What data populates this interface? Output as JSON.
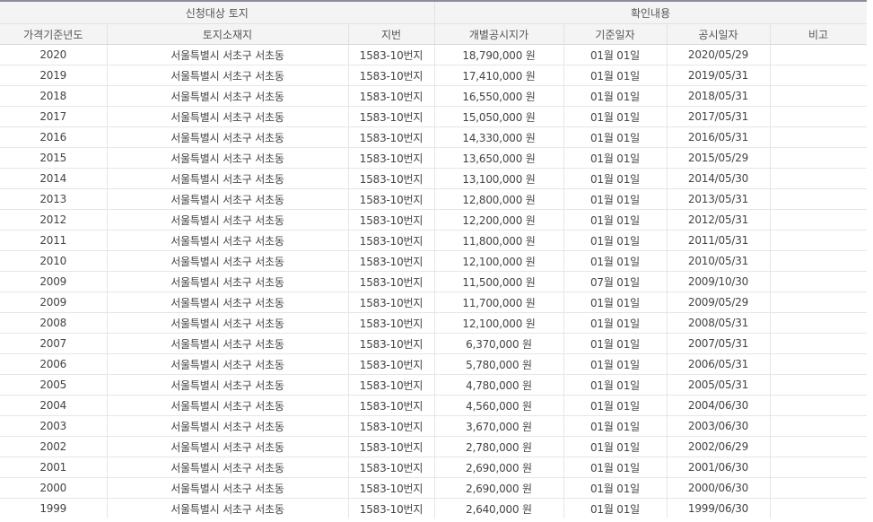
{
  "header": {
    "group_land": "신청대상 토지",
    "group_confirm": "확인내용",
    "columns": [
      "가격기준년도",
      "토지소재지",
      "지번",
      "개별공시지가",
      "기준일자",
      "공시일자",
      "비고"
    ]
  },
  "rows": [
    [
      "2020",
      "서울특별시 서초구 서초동",
      "1583-10번지",
      "18,790,000 원",
      "01월 01일",
      "2020/05/29",
      ""
    ],
    [
      "2019",
      "서울특별시 서초구 서초동",
      "1583-10번지",
      "17,410,000 원",
      "01월 01일",
      "2019/05/31",
      ""
    ],
    [
      "2018",
      "서울특별시 서초구 서초동",
      "1583-10번지",
      "16,550,000 원",
      "01월 01일",
      "2018/05/31",
      ""
    ],
    [
      "2017",
      "서울특별시 서초구 서초동",
      "1583-10번지",
      "15,050,000 원",
      "01월 01일",
      "2017/05/31",
      ""
    ],
    [
      "2016",
      "서울특별시 서초구 서초동",
      "1583-10번지",
      "14,330,000 원",
      "01월 01일",
      "2016/05/31",
      ""
    ],
    [
      "2015",
      "서울특별시 서초구 서초동",
      "1583-10번지",
      "13,650,000 원",
      "01월 01일",
      "2015/05/29",
      ""
    ],
    [
      "2014",
      "서울특별시 서초구 서초동",
      "1583-10번지",
      "13,100,000 원",
      "01월 01일",
      "2014/05/30",
      ""
    ],
    [
      "2013",
      "서울특별시 서초구 서초동",
      "1583-10번지",
      "12,800,000 원",
      "01월 01일",
      "2013/05/31",
      ""
    ],
    [
      "2012",
      "서울특별시 서초구 서초동",
      "1583-10번지",
      "12,200,000 원",
      "01월 01일",
      "2012/05/31",
      ""
    ],
    [
      "2011",
      "서울특별시 서초구 서초동",
      "1583-10번지",
      "11,800,000 원",
      "01월 01일",
      "2011/05/31",
      ""
    ],
    [
      "2010",
      "서울특별시 서초구 서초동",
      "1583-10번지",
      "12,100,000 원",
      "01월 01일",
      "2010/05/31",
      ""
    ],
    [
      "2009",
      "서울특별시 서초구 서초동",
      "1583-10번지",
      "11,500,000 원",
      "07월 01일",
      "2009/10/30",
      ""
    ],
    [
      "2009",
      "서울특별시 서초구 서초동",
      "1583-10번지",
      "11,700,000 원",
      "01월 01일",
      "2009/05/29",
      ""
    ],
    [
      "2008",
      "서울특별시 서초구 서초동",
      "1583-10번지",
      "12,100,000 원",
      "01월 01일",
      "2008/05/31",
      ""
    ],
    [
      "2007",
      "서울특별시 서초구 서초동",
      "1583-10번지",
      "6,370,000 원",
      "01월 01일",
      "2007/05/31",
      ""
    ],
    [
      "2006",
      "서울특별시 서초구 서초동",
      "1583-10번지",
      "5,780,000 원",
      "01월 01일",
      "2006/05/31",
      ""
    ],
    [
      "2005",
      "서울특별시 서초구 서초동",
      "1583-10번지",
      "4,780,000 원",
      "01월 01일",
      "2005/05/31",
      ""
    ],
    [
      "2004",
      "서울특별시 서초구 서초동",
      "1583-10번지",
      "4,560,000 원",
      "01월 01일",
      "2004/06/30",
      ""
    ],
    [
      "2003",
      "서울특별시 서초구 서초동",
      "1583-10번지",
      "3,670,000 원",
      "01월 01일",
      "2003/06/30",
      ""
    ],
    [
      "2002",
      "서울특별시 서초구 서초동",
      "1583-10번지",
      "2,780,000 원",
      "01월 01일",
      "2002/06/29",
      ""
    ],
    [
      "2001",
      "서울특별시 서초구 서초동",
      "1583-10번지",
      "2,690,000 원",
      "01월 01일",
      "2001/06/30",
      ""
    ],
    [
      "2000",
      "서울특별시 서초구 서초동",
      "1583-10번지",
      "2,690,000 원",
      "01월 01일",
      "2000/06/30",
      ""
    ],
    [
      "1999",
      "서울특별시 서초구 서초동",
      "1583-10번지",
      "2,640,000 원",
      "01월 01일",
      "1999/06/30",
      ""
    ]
  ]
}
